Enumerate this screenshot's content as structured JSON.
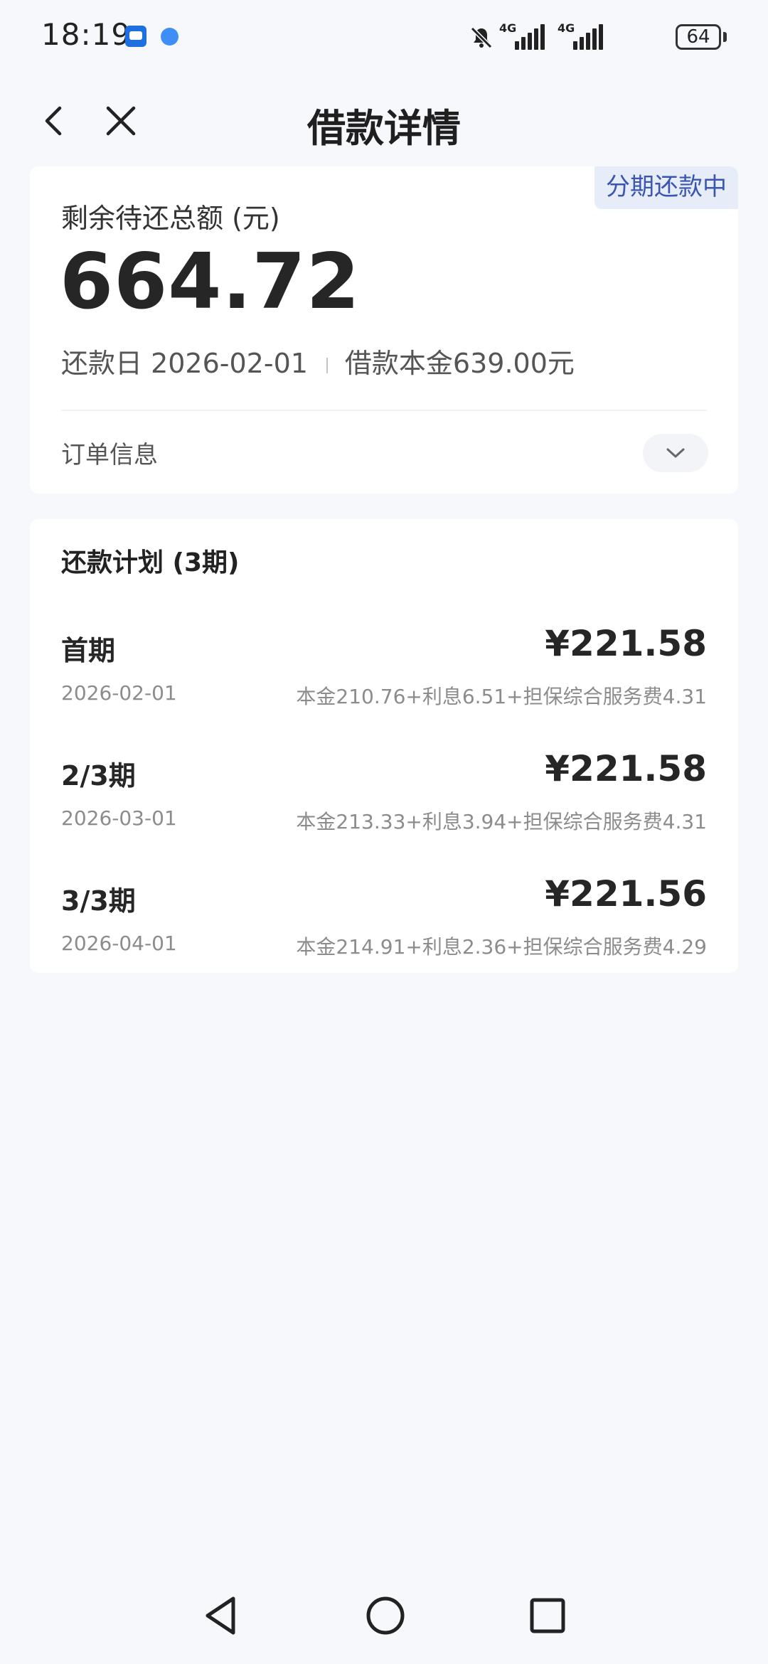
{
  "status_bar": {
    "time": "18:19",
    "network_tag_1": "4G",
    "network_tag_2": "4G",
    "battery": "64"
  },
  "header": {
    "title": "借款详情"
  },
  "summary": {
    "badge": "分期还款中",
    "remaining_label": "剩余待还总额 (元)",
    "remaining_amount": "664.72",
    "repay_date": "还款日 2026-02-01",
    "principal": "借款本金639.00元",
    "order_info_label": "订单信息"
  },
  "plan": {
    "title": "还款计划 (3期)",
    "items": [
      {
        "period": "首期",
        "amount": "¥221.58",
        "date": "2026-02-01",
        "detail": "本金210.76+利息6.51+担保综合服务费4.31"
      },
      {
        "period": "2/3期",
        "amount": "¥221.58",
        "date": "2026-03-01",
        "detail": "本金213.33+利息3.94+担保综合服务费4.31"
      },
      {
        "period": "3/3期",
        "amount": "¥221.56",
        "date": "2026-04-01",
        "detail": "本金214.91+利息2.36+担保综合服务费4.29"
      }
    ]
  },
  "colors": {
    "background": "#f7f8fc",
    "badge_bg": "#e7ecf9",
    "badge_text": "#3a56b0",
    "muted_text": "#8c8c8c"
  }
}
